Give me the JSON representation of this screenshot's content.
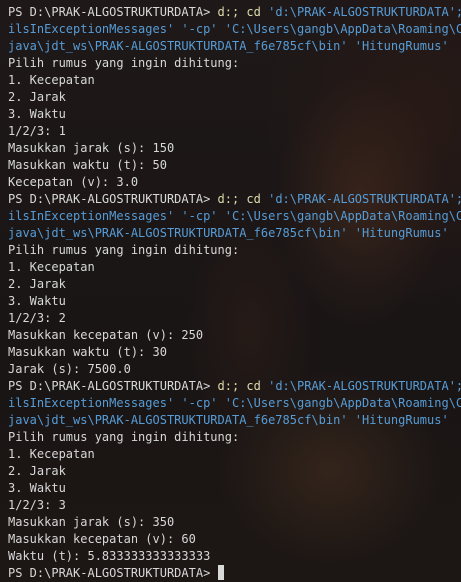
{
  "terminal": {
    "runs": [
      {
        "prompt": "PS D:\\PRAK-ALGOSTRUKTURDATA> ",
        "cmd": "d:; cd ",
        "cmd_path": "'d:\\PRAK-ALGOSTRUKTURDATA';",
        "cont1": "ilsInExceptionMessages' '-cp' 'C:\\Users\\gangb\\AppData\\Roaming\\Cod",
        "cont2": "java\\jdt_ws\\PRAK-ALGOSTRUKTURDATA_f6e785cf\\bin' 'HitungRumus'",
        "output": [
          "Pilih rumus yang ingin dihitung:",
          "1. Kecepatan",
          "2. Jarak",
          "3. Waktu",
          "1/2/3: 1",
          "Masukkan jarak (s): 150",
          "Masukkan waktu (t): 50",
          "Kecepatan (v): 3.0"
        ]
      },
      {
        "prompt": "PS D:\\PRAK-ALGOSTRUKTURDATA> ",
        "cmd": "d:; cd ",
        "cmd_path": "'d:\\PRAK-ALGOSTRUKTURDATA';",
        "cont1": "ilsInExceptionMessages' '-cp' 'C:\\Users\\gangb\\AppData\\Roaming\\Cod",
        "cont2": "java\\jdt_ws\\PRAK-ALGOSTRUKTURDATA_f6e785cf\\bin' 'HitungRumus'",
        "output": [
          "Pilih rumus yang ingin dihitung:",
          "1. Kecepatan",
          "2. Jarak",
          "3. Waktu",
          "1/2/3: 2",
          "Masukkan kecepatan (v): 250",
          "Masukkan waktu (t): 30",
          "Jarak (s): 7500.0"
        ]
      },
      {
        "prompt": "PS D:\\PRAK-ALGOSTRUKTURDATA> ",
        "cmd": "d:; cd ",
        "cmd_path": "'d:\\PRAK-ALGOSTRUKTURDATA';",
        "cont1": "ilsInExceptionMessages' '-cp' 'C:\\Users\\gangb\\AppData\\Roaming\\Cod",
        "cont2": "java\\jdt_ws\\PRAK-ALGOSTRUKTURDATA_f6e785cf\\bin' 'HitungRumus'",
        "output": [
          "Pilih rumus yang ingin dihitung:",
          "1. Kecepatan",
          "2. Jarak",
          "3. Waktu",
          "1/2/3: 3",
          "Masukkan jarak (s): 350",
          "Masukkan kecepatan (v): 60",
          "Waktu (t): 5.833333333333333"
        ]
      }
    ],
    "final_prompt": "PS D:\\PRAK-ALGOSTRUKTURDATA> ",
    "colors": {
      "background": "#1b1717",
      "text": "#d8d8d8",
      "command": "#dcdcaa",
      "string": "#569cd6"
    }
  }
}
